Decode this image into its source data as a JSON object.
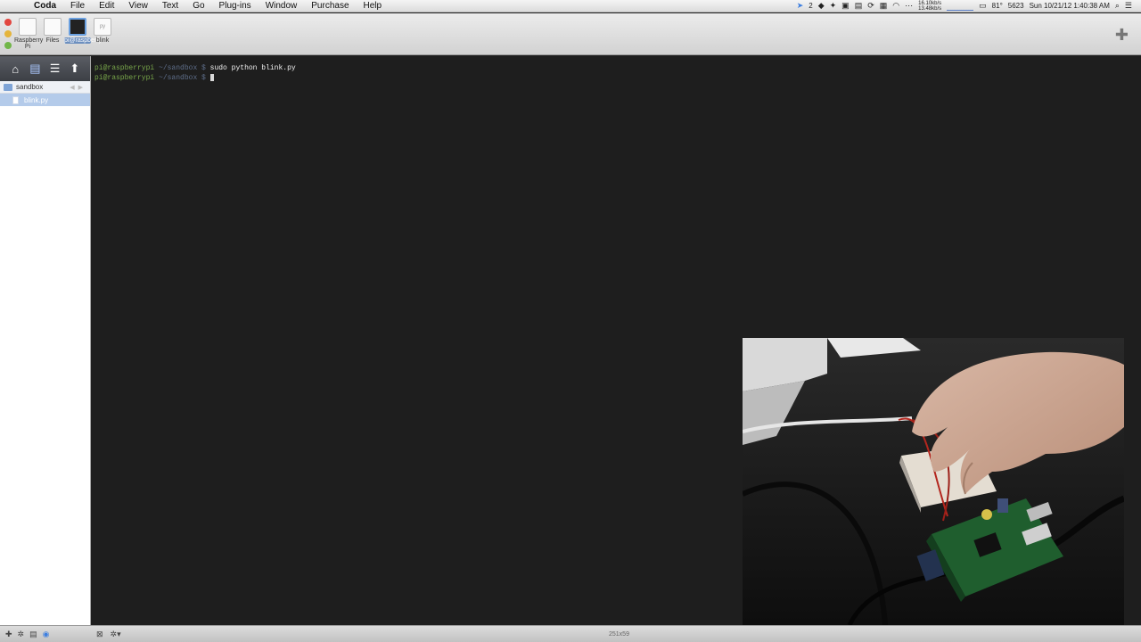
{
  "menubar": {
    "app": "Coda",
    "items": [
      "File",
      "Edit",
      "View",
      "Text",
      "Go",
      "Plug-ins",
      "Window",
      "Purchase",
      "Help"
    ],
    "status_badge": "2",
    "net_up": "16.10kb/s",
    "net_down": "13.48kb/s",
    "temp": "81°",
    "cpu": "5623",
    "datetime": "Sun 10/21/12  1:40:38 AM"
  },
  "toolbar": {
    "tabs": [
      {
        "label": "Raspberry Pi"
      },
      {
        "label": "Files"
      },
      {
        "label": "pi@raspberry"
      },
      {
        "label": "blink",
        "thumb": "py"
      }
    ]
  },
  "sidebar": {
    "folder": "sandbox",
    "file": "blink.py"
  },
  "terminal": {
    "lines": [
      {
        "user": "pi@raspberrypi",
        "path": "~/sandbox $",
        "command": "sudo python blink.py"
      },
      {
        "user": "pi@raspberrypi",
        "path": "~/sandbox $",
        "command": ""
      }
    ]
  },
  "statusbar": {
    "size": "251x59"
  }
}
